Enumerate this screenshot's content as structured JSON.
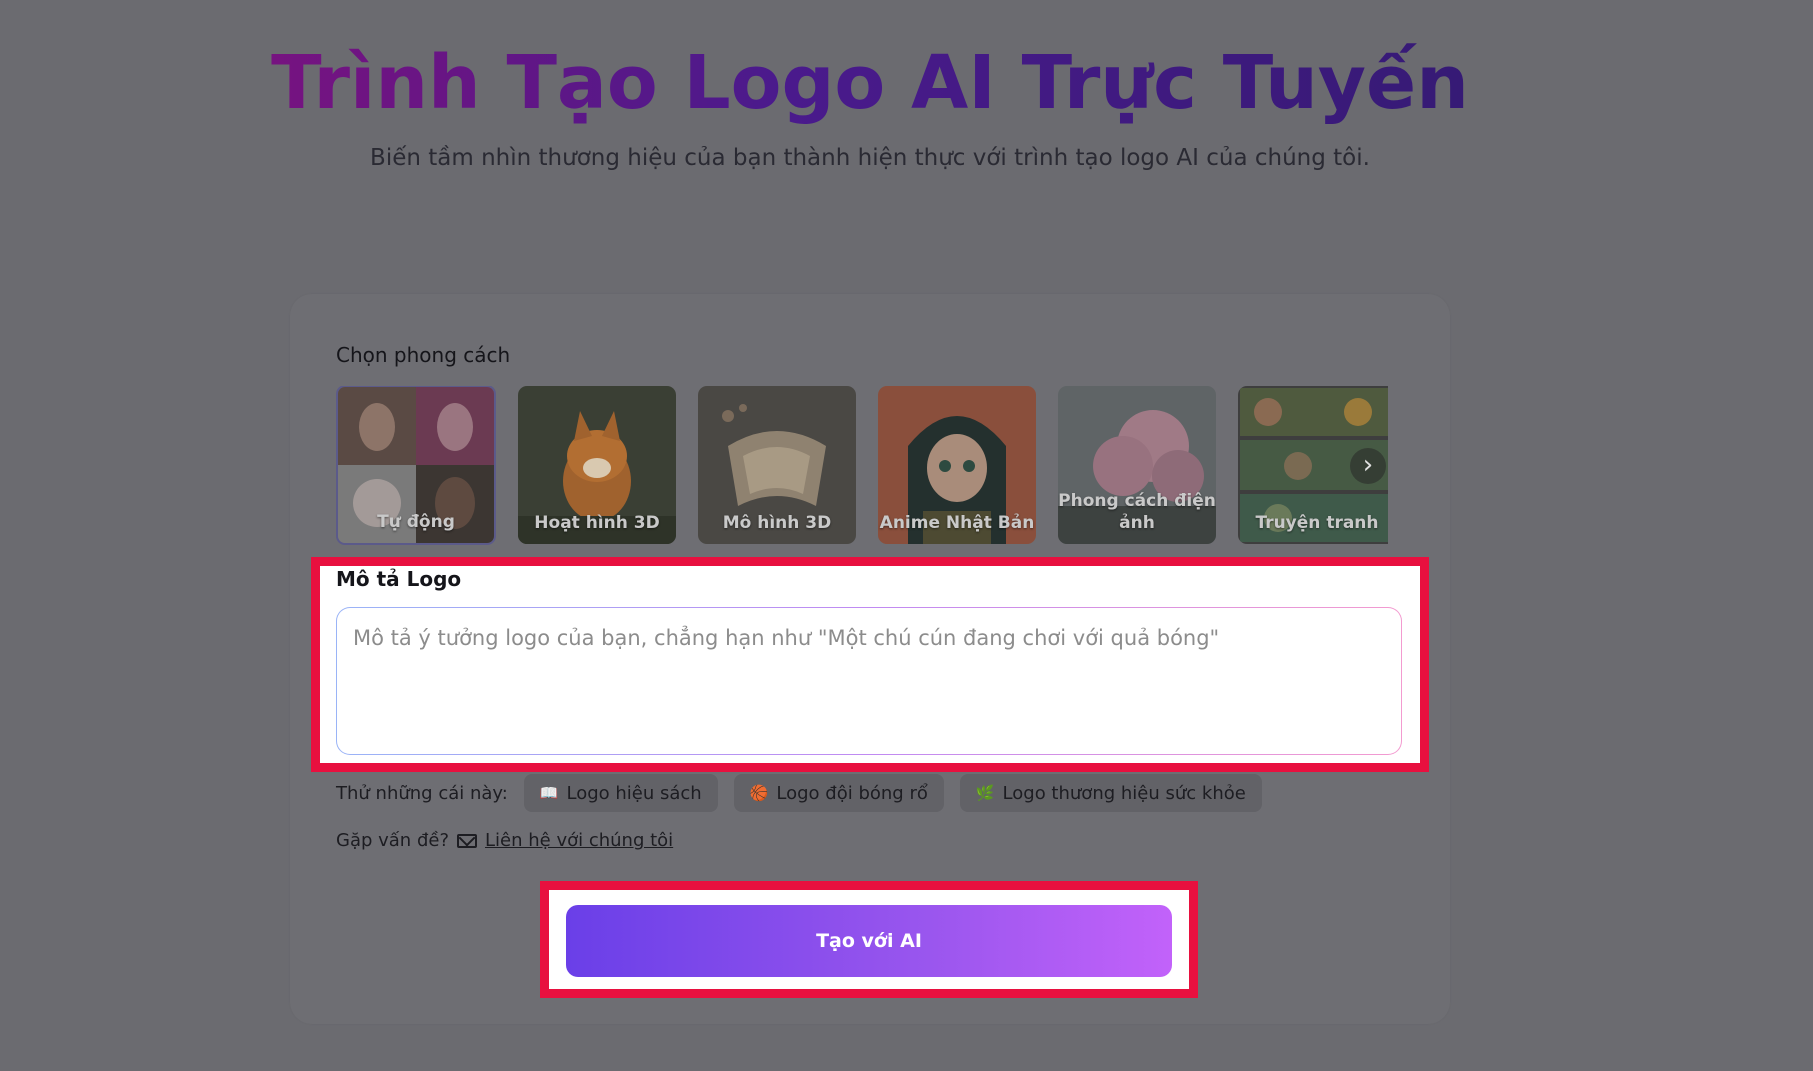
{
  "hero": {
    "title": "Trình Tạo Logo AI Trực Tuyến",
    "subtitle": "Biến tầm nhìn thương hiệu của bạn thành hiện thực với trình tạo logo AI của chúng tôi."
  },
  "styles": {
    "label": "Chọn phong cách",
    "items": [
      {
        "name": "Tự động",
        "selected": true
      },
      {
        "name": "Hoạt hình 3D",
        "selected": false
      },
      {
        "name": "Mô hình 3D",
        "selected": false
      },
      {
        "name": "Anime Nhật Bản",
        "selected": false
      },
      {
        "name": "Phong cách điện ảnh",
        "selected": false
      },
      {
        "name": "Truyện tranh",
        "selected": false
      }
    ],
    "next_icon": "chevron-right-icon"
  },
  "description": {
    "label": "Mô tả Logo",
    "placeholder": "Mô tả ý tưởng logo của bạn, chẳng hạn như \"Một chú cún đang chơi với quả bóng\"",
    "value": ""
  },
  "suggestions": {
    "label": "Thử những cái này:",
    "chips": [
      {
        "icon": "📖",
        "label": "Logo hiệu sách"
      },
      {
        "icon": "🏀",
        "label": "Logo đội bóng rổ"
      },
      {
        "icon": "🌿",
        "label": "Logo thương hiệu sức khỏe"
      }
    ]
  },
  "contact": {
    "prompt": "Gặp vấn đề?",
    "link": "Liên hệ với chúng tôi",
    "icon": "mail-icon"
  },
  "generate": {
    "label": "Tạo với AI"
  },
  "colors": {
    "highlight": "#e8103f",
    "button_start": "#6a3fe8",
    "button_end": "#c262fa",
    "overlay": "#6b6b70"
  }
}
